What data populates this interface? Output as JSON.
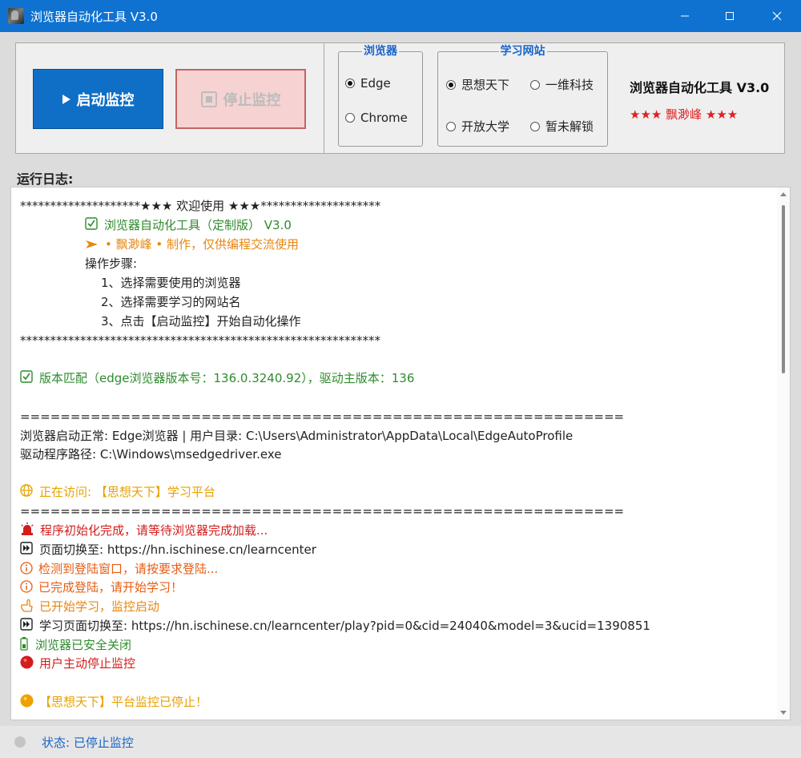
{
  "window": {
    "title": "浏览器自动化工具 V3.0",
    "titlebar_color": "#0f72d0"
  },
  "controls": {
    "start_label": "启动监控",
    "stop_label": "停止监控",
    "start_color": "#0f6fc6",
    "stop_color": "#f6d2d2"
  },
  "browser_group": {
    "title": "浏览器",
    "options": [
      {
        "label": "Edge",
        "selected": true
      },
      {
        "label": "Chrome",
        "selected": false
      }
    ]
  },
  "site_group": {
    "title": "学习网站",
    "options": [
      {
        "label": "思想天下",
        "selected": true
      },
      {
        "label": "一维科技",
        "selected": false
      },
      {
        "label": "开放大学",
        "selected": false
      },
      {
        "label": "暂未解锁",
        "selected": false
      }
    ]
  },
  "brand": {
    "name": "浏览器自动化工具 V3.0",
    "author": "★★★ 飘渺峰 ★★★"
  },
  "log": {
    "label": "运行日志:",
    "lines": [
      "********************★★★ 欢迎使用 ★★★********************",
      "浏览器自动化工具（定制版） V3.0",
      "• 飘渺峰 • 制作，仅供编程交流使用",
      "操作步骤:",
      "1、选择需要使用的浏览器",
      "2、选择需要学习的网站名",
      "3、点击【启动监控】开始自动化操作",
      "************************************************************",
      "版本匹配（edge浏览器版本号：136.0.3240.92），驱动主版本：136",
      "============================================================",
      "浏览器启动正常: Edge浏览器 | 用户目录: C:\\Users\\Administrator\\AppData\\Local\\EdgeAutoProfile",
      "驱动程序路径: C:\\Windows\\msedgedriver.exe",
      "正在访问: 【思想天下】学习平台",
      "============================================================",
      "程序初始化完成，请等待浏览器完成加载...",
      "页面切换至: https://hn.ischinese.cn/learncenter",
      "检测到登陆窗口，请按要求登陆...",
      "已完成登陆，请开始学习！",
      "已开始学习，监控启动",
      "学习页面切换至: https://hn.ischinese.cn/learncenter/play?pid=0&cid=24040&model=3&ucid=1390851",
      "浏览器已安全关闭",
      "用户主动停止监控",
      "【思想天下】平台监控已停止！"
    ]
  },
  "status": {
    "text": "状态: 已停止监控"
  }
}
